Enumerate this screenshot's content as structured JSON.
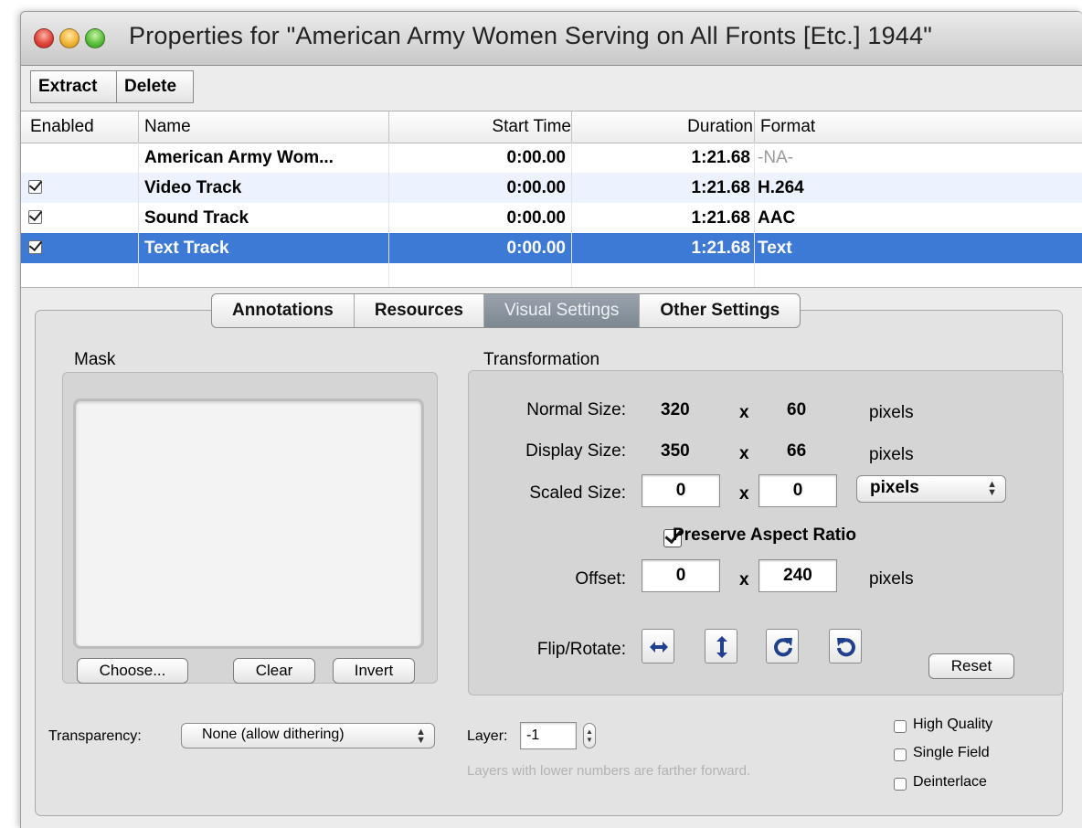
{
  "window": {
    "title": "Properties for \"American Army Women Serving on All Fronts [Etc.] 1944\""
  },
  "toolbar": {
    "extract_label": "Extract",
    "delete_label": "Delete"
  },
  "table": {
    "columns": [
      "Enabled",
      "Name",
      "Start Time",
      "Duration",
      "Format"
    ],
    "rows": [
      {
        "enabled": false,
        "name": "American Army Wom...",
        "start": "0:00.00",
        "duration": "1:21.68",
        "format": "-NA-"
      },
      {
        "enabled": true,
        "name": "Video Track",
        "start": "0:00.00",
        "duration": "1:21.68",
        "format": "H.264"
      },
      {
        "enabled": true,
        "name": "Sound Track",
        "start": "0:00.00",
        "duration": "1:21.68",
        "format": "AAC"
      },
      {
        "enabled": true,
        "name": "Text Track",
        "start": "0:00.00",
        "duration": "1:21.68",
        "format": "Text",
        "selected": true
      }
    ]
  },
  "tabs": {
    "annotations": "Annotations",
    "resources": "Resources",
    "visual": "Visual Settings",
    "other": "Other Settings",
    "active": "Visual Settings"
  },
  "mask": {
    "title": "Mask",
    "choose": "Choose...",
    "clear": "Clear",
    "invert": "Invert"
  },
  "transformation": {
    "title": "Transformation",
    "normal_label": "Normal Size:",
    "normal_w": "320",
    "normal_h": "60",
    "display_label": "Display Size:",
    "display_w": "350",
    "display_h": "66",
    "scaled_label": "Scaled Size:",
    "scaled_w": "0",
    "scaled_h": "0",
    "x": "x",
    "units": "pixels",
    "units_popup": "pixels",
    "preserve_label": "Preserve Aspect Ratio",
    "preserve_checked": true,
    "offset_label": "Offset:",
    "offset_x": "0",
    "offset_y": "240",
    "flip_label": "Flip/Rotate:",
    "reset": "Reset"
  },
  "transparency": {
    "label": "Transparency:",
    "value": "None (allow dithering)"
  },
  "layer": {
    "label": "Layer:",
    "value": "-1",
    "hint": "Layers with lower numbers are farther forward."
  },
  "options": {
    "high_quality": "High Quality",
    "single_field": "Single Field",
    "deinterlace": "Deinterlace"
  },
  "icons": [
    "flip-horizontal-icon",
    "flip-vertical-icon",
    "rotate-clockwise-icon",
    "rotate-counterclockwise-icon",
    "up-down-arrows-icon",
    "checkmark-icon"
  ],
  "colors": {
    "selection": "#3d7ad6",
    "alt_row": "#edf3fe",
    "icon_blue": "#1f3f8f"
  }
}
